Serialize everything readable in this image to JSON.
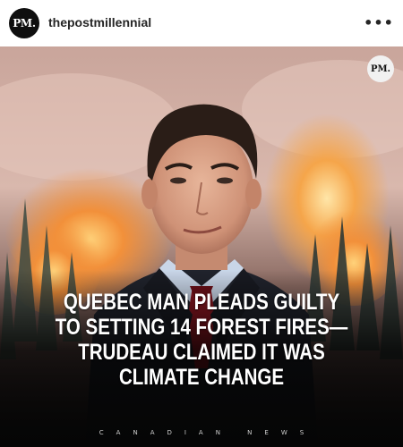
{
  "post": {
    "avatar_text": "PM.",
    "username": "thepostmillennial",
    "more_label": "•••"
  },
  "image": {
    "watermark_text": "PM.",
    "headline_lines": [
      "QUEBEC MAN PLEADS GUILTY",
      "TO SETTING 14 FOREST FIRES—",
      "TRUDEAU CLAIMED IT WAS",
      "CLIMATE CHANGE"
    ],
    "brand_text": "CANADIAN NEWS"
  },
  "colors": {
    "suit": "#20232c",
    "shirt": "#c9d6e8",
    "tie": "#8a1620",
    "fire": "#f39a3a",
    "backdrop": "#0d0d0f"
  }
}
